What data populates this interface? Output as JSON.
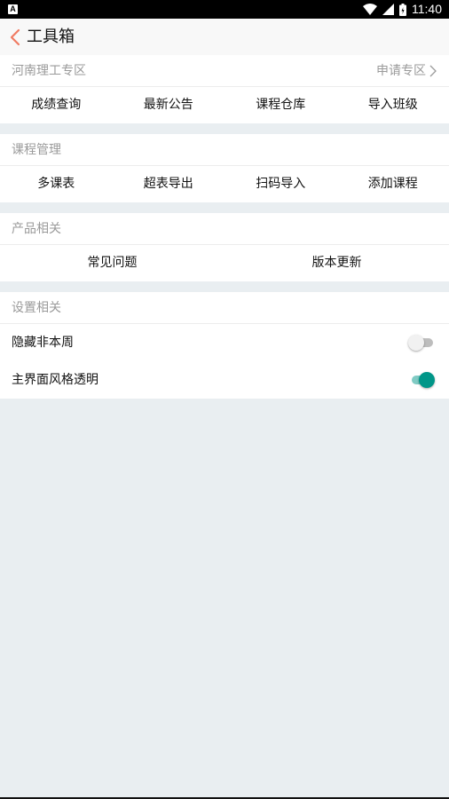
{
  "status_bar": {
    "time": "11:40",
    "app_icon_letter": "A"
  },
  "header": {
    "title": "工具箱",
    "back_icon": "chevron-left-icon"
  },
  "zone": {
    "title": "河南理工专区",
    "apply_label": "申请专区",
    "items": [
      "成绩查询",
      "最新公告",
      "课程仓库",
      "导入班级"
    ]
  },
  "course_management": {
    "title": "课程管理",
    "items": [
      "多课表",
      "超表导出",
      "扫码导入",
      "添加课程"
    ]
  },
  "product": {
    "title": "产品相关",
    "items": [
      "常见问题",
      "版本更新"
    ]
  },
  "settings": {
    "title": "设置相关",
    "hide_non_week": {
      "label": "隐藏非本周",
      "enabled": false
    },
    "transparent_style": {
      "label": "主界面风格透明",
      "enabled": true
    }
  },
  "colors": {
    "accent": "#009688",
    "back_arrow": "#f07b63",
    "background": "#e9eef1"
  }
}
